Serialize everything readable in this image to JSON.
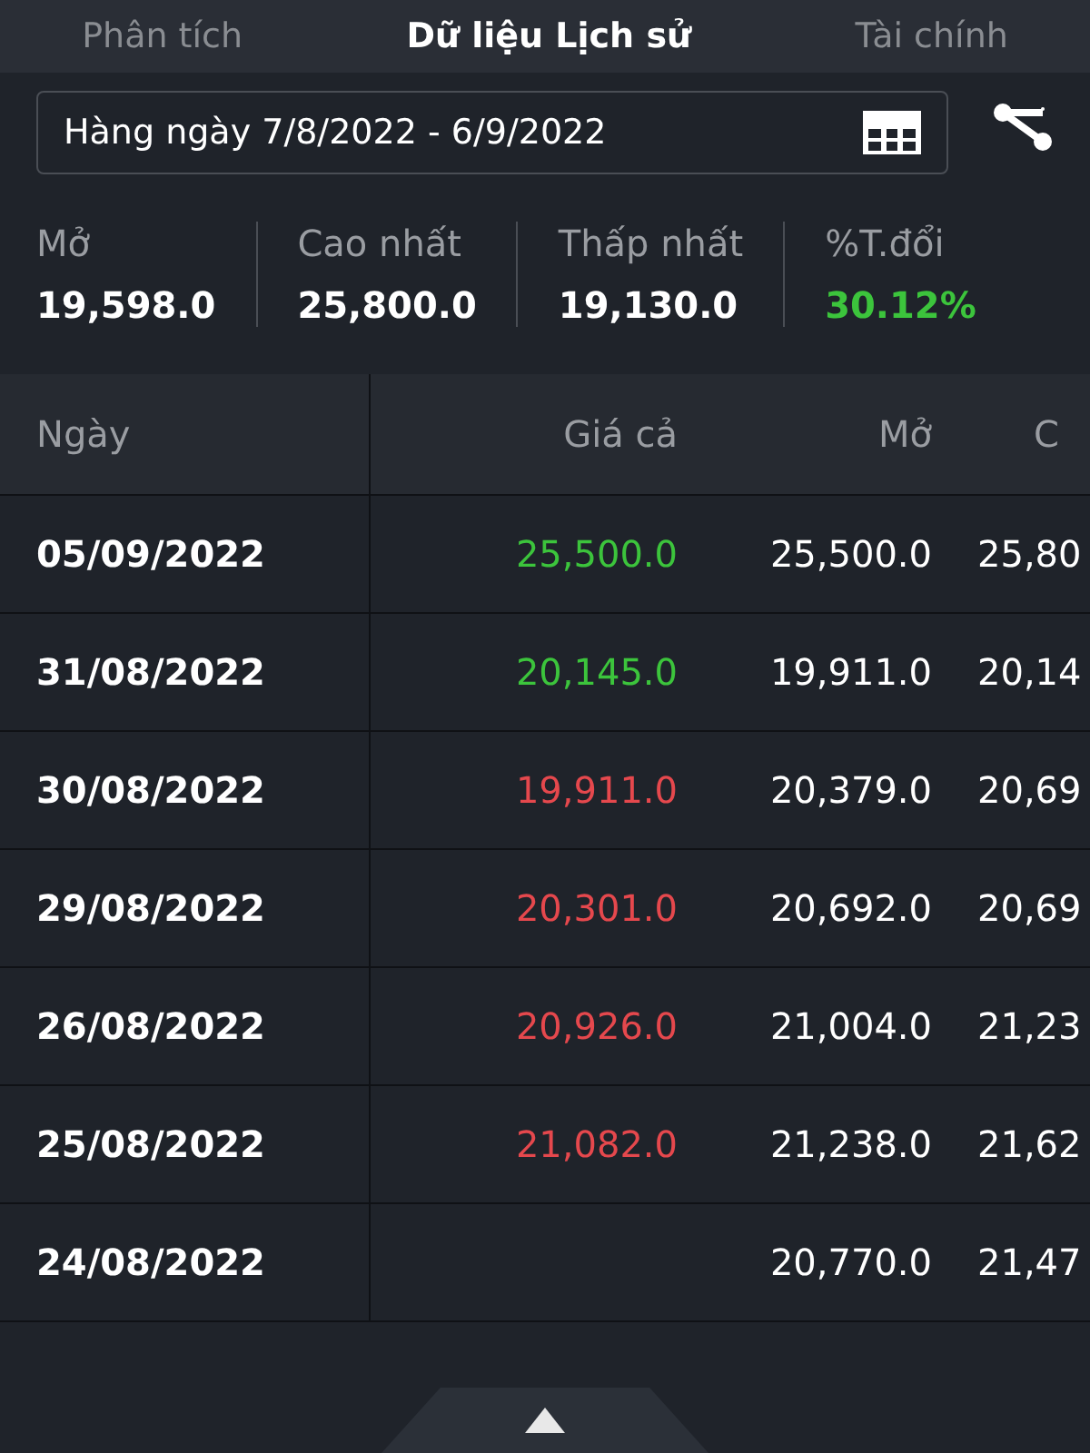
{
  "tabs": [
    {
      "label": "Phân tích",
      "selected": false
    },
    {
      "label": "Dữ liệu Lịch sử",
      "selected": true
    },
    {
      "label": "Tài chính",
      "selected": false
    }
  ],
  "date_range": {
    "value": "Hàng ngày 7/8/2022 - 6/9/2022"
  },
  "stats": [
    {
      "label": "Mở",
      "value": "19,598.0",
      "color": "#ffffff"
    },
    {
      "label": "Cao nhất",
      "value": "25,800.0",
      "color": "#ffffff"
    },
    {
      "label": "Thấp nhất",
      "value": "19,130.0",
      "color": "#ffffff"
    },
    {
      "label": "%T.đổi",
      "value": "30.12%",
      "color": "#3cc43c"
    }
  ],
  "table": {
    "columns": [
      "Ngày",
      "Giá cả",
      "Mở",
      "C"
    ],
    "rows": [
      {
        "date": "05/09/2022",
        "price": "25,500.0",
        "color": "#3cc43c",
        "open": "25,500.0",
        "column_4": "25,80"
      },
      {
        "date": "31/08/2022",
        "price": "20,145.0",
        "color": "#3cc43c",
        "open": "19,911.0",
        "column_4": "20,14"
      },
      {
        "date": "30/08/2022",
        "price": "19,911.0",
        "color": "#e5484d",
        "open": "20,379.0",
        "column_4": "20,69"
      },
      {
        "date": "29/08/2022",
        "price": "20,301.0",
        "color": "#e5484d",
        "open": "20,692.0",
        "column_4": "20,69"
      },
      {
        "date": "26/08/2022",
        "price": "20,926.0",
        "color": "#e5484d",
        "open": "21,004.0",
        "column_4": "21,23"
      },
      {
        "date": "25/08/2022",
        "price": "21,082.0",
        "color": "#e5484d",
        "open": "21,238.0",
        "column_4": "21,62"
      },
      {
        "date": "24/08/2022",
        "open": "20,770.0",
        "column_4": "21,47"
      }
    ]
  }
}
